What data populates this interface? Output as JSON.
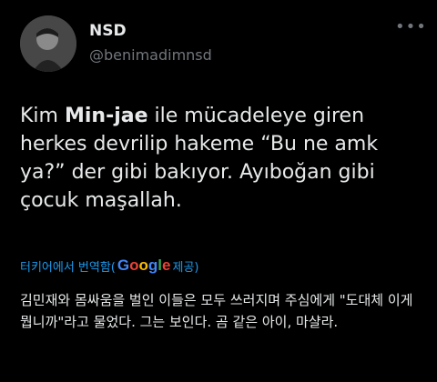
{
  "author": {
    "name": "NSD",
    "handle": "@benimadimnsd"
  },
  "more_menu": "•••",
  "tweet": {
    "part1": "Kim ",
    "bold": "Min-jae",
    "part2": " ile mücadeleye giren herkes devrilip hakeme “Bu ne amk ya?” der gibi bakıyor. Ayıboğan gibi çocuk maşallah."
  },
  "translation": {
    "label_prefix": "터키어에서 번역함(",
    "google": [
      "G",
      "o",
      "o",
      "g",
      "l",
      "e"
    ],
    "label_suffix": " 제공)",
    "text": "김민재와 몸싸움을 벌인 이들은 모두 쓰러지며 주심에게 \"도대체 이게 뭡니까\"라고 물었다. 그는 보인다. 곰 같은 아이, 마샬라."
  },
  "colors": {
    "background": "#000000",
    "link": "#1d9bf0",
    "muted": "#71767b"
  }
}
